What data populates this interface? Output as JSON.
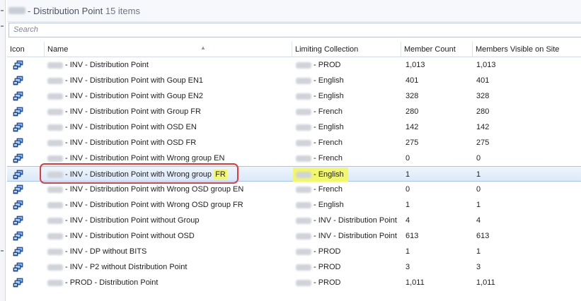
{
  "header": {
    "title": "- Distribution Point",
    "count": "15 items"
  },
  "search": {
    "placeholder": "Search"
  },
  "columns": {
    "icon": "Icon",
    "name": "Name",
    "limit": "Limiting Collection",
    "count": "Member Count",
    "visible": "Members Visible on Site"
  },
  "rows": [
    {
      "name": "- INV - Distribution Point",
      "limit": "- PROD",
      "count": "1,013",
      "visible": "1,013"
    },
    {
      "name": "- INV - Distribution Point with Goup EN1",
      "limit": "- English",
      "count": "401",
      "visible": "401"
    },
    {
      "name": "- INV - Distribution Point with Goup EN2",
      "limit": "- English",
      "count": "328",
      "visible": "328"
    },
    {
      "name": "- INV - Distribution Point with Group FR",
      "limit": "- French",
      "count": "280",
      "visible": "280"
    },
    {
      "name": "- INV - Distribution Point with OSD EN",
      "limit": "- English",
      "count": "142",
      "visible": "142"
    },
    {
      "name": "- INV - Distribution Point with OSD FR",
      "limit": "- French",
      "count": "275",
      "visible": "275"
    },
    {
      "name": "- INV - Distribution Point with Wrong group EN",
      "limit": "- French",
      "count": "0",
      "visible": "0"
    },
    {
      "name": "- INV - Distribution Point with Wrong group",
      "name_suffix": "FR",
      "limit": "- English",
      "count": "1",
      "visible": "1"
    },
    {
      "name": "- INV - Distribution Point with Wrong OSD group EN",
      "limit": "- French",
      "count": "0",
      "visible": "0"
    },
    {
      "name": "- INV - Distribution Point with Wrong OSD group FR",
      "limit": "- English",
      "count": "1",
      "visible": "1"
    },
    {
      "name": "- INV - Distribution Point without Group",
      "limit": "- INV - Distribution Point",
      "count": "4",
      "visible": "4"
    },
    {
      "name": "- INV - Distribution Point without OSD",
      "limit": "- INV - Distribution Point",
      "count": "613",
      "visible": "613"
    },
    {
      "name": "- INV - DP without BITS",
      "limit": "- PROD",
      "count": "1",
      "visible": "1"
    },
    {
      "name": "- INV - P2 without Distribution Point",
      "limit": "- PROD",
      "count": "3",
      "visible": "3"
    },
    {
      "name": "- PROD - Distribution Point",
      "limit": "- PROD",
      "count": "1,011",
      "visible": "1,011"
    }
  ],
  "row_icon": "device-collection-icon",
  "selected_row_index": 7,
  "colors": {
    "selection": "#dbe9f9",
    "highlight": "#f3f76b",
    "annotation": "#e43a3a"
  }
}
